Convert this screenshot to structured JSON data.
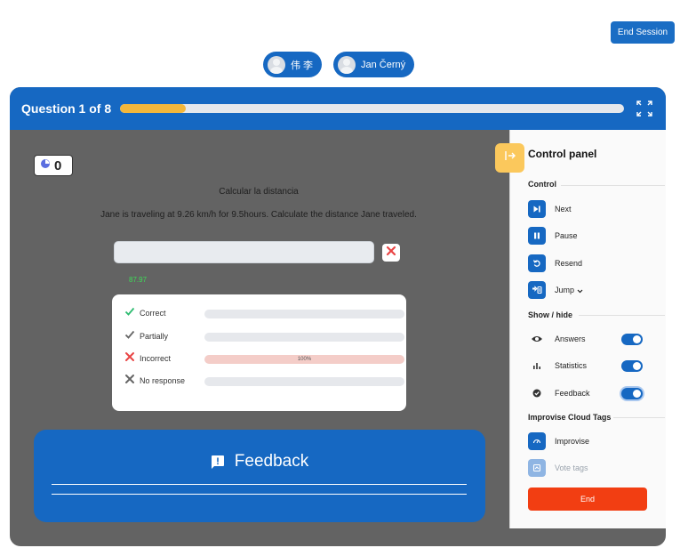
{
  "header": {
    "end_session_label": "End Session"
  },
  "participants": [
    {
      "name": "伟 李"
    },
    {
      "name": "Jan Černý"
    }
  ],
  "question": {
    "title": "Question 1 of 8",
    "progress_fraction": 0.13,
    "score": "0",
    "heading": "Calcular la distancia",
    "text": "Jane is traveling at 9.26 km/h for 9.5hours. Calculate the distance Jane traveled.",
    "answer_input_value": "",
    "answer_value": "87.97"
  },
  "stats": {
    "rows": [
      {
        "label": "Correct",
        "icon": "check-icon",
        "percent_label": "",
        "fill": 0
      },
      {
        "label": "Partially",
        "icon": "check-icon",
        "percent_label": "",
        "fill": 0
      },
      {
        "label": "Incorrect",
        "icon": "x-icon",
        "percent_label": "100%",
        "fill": 1
      },
      {
        "label": "No response",
        "icon": "x-icon",
        "percent_label": "",
        "fill": 0
      }
    ]
  },
  "feedback": {
    "title": "Feedback"
  },
  "panel": {
    "title": "Control panel",
    "control_section": "Control",
    "next_label": "Next",
    "pause_label": "Pause",
    "resend_label": "Resend",
    "jump_label": "Jump",
    "showhide_section": "Show / hide",
    "answers_label": "Answers",
    "answers_on": true,
    "statistics_label": "Statistics",
    "statistics_on": true,
    "feedback_label": "Feedback",
    "feedback_on": true,
    "improvise_section": "Improvise Cloud Tags",
    "improvise_label": "Improvise",
    "vote_tags_label": "Vote tags",
    "end_label": "End"
  },
  "colors": {
    "primary": "#1668c2",
    "accent": "#f3b73b",
    "danger": "#f23e12",
    "success": "#3ddc57"
  }
}
